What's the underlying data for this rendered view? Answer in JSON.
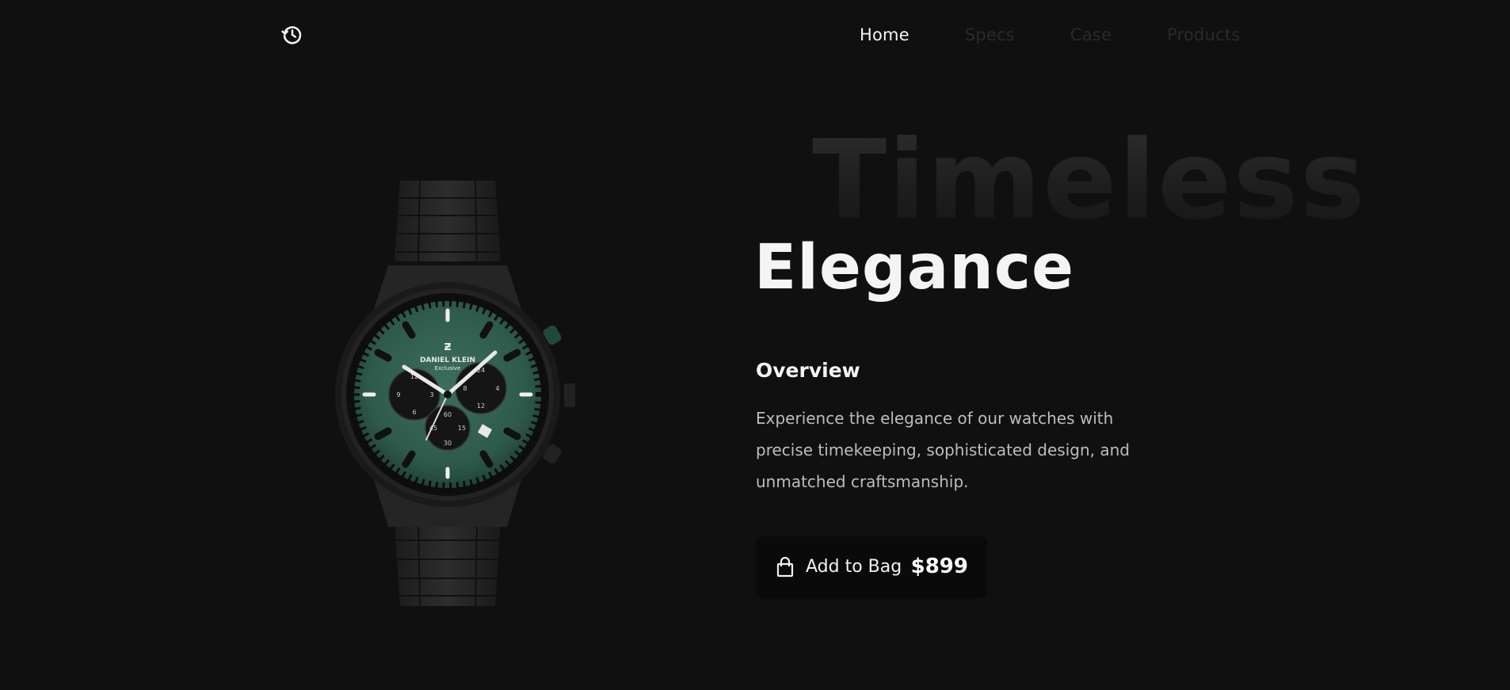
{
  "header": {
    "logo_icon": "history-icon",
    "nav": [
      {
        "label": "Home",
        "active": true
      },
      {
        "label": "Specs",
        "active": false
      },
      {
        "label": "Case",
        "active": false
      },
      {
        "label": "Products",
        "active": false
      }
    ]
  },
  "hero": {
    "background_word": "Timeless",
    "headline": "Elegance",
    "section_title": "Overview",
    "description": "Experience the elegance of our watches with precise timekeeping, sophisticated design, and unmatched craftsmanship."
  },
  "product": {
    "image": "chronograph-watch",
    "brand": "DANIEL KLEIN",
    "brand_sub": "Exclusive",
    "dial_color": "#2e5a4c",
    "subdial_numbers": [
      "12",
      "3",
      "9",
      "6",
      "24",
      "4",
      "8",
      "12",
      "60",
      "45",
      "15",
      "30"
    ]
  },
  "cta": {
    "icon": "shopping-bag-icon",
    "label": "Add to Bag",
    "price": "$899"
  },
  "colors": {
    "background": "#101010",
    "nav_inactive": "#2a2a2a",
    "text_primary": "#f4f4f4",
    "text_secondary": "#bdbdbd"
  }
}
